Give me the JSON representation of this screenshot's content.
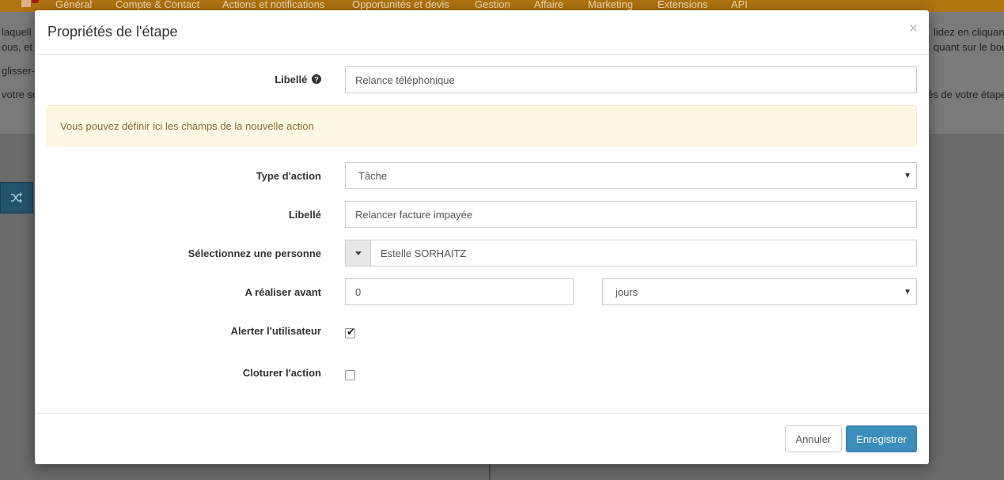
{
  "background": {
    "nav_items": [
      "Général",
      "Compte & Contact",
      "Actions et notifications",
      "Opportunités et devis",
      "Gestion",
      "Affaire",
      "Marketing",
      "Extensions",
      "API"
    ],
    "left_snippets": [
      "laquell",
      "ous, et",
      "glisser-",
      "votre so"
    ],
    "right_snippets": [
      "lidez en cliquant",
      "quant sur le bou",
      "és de votre étape"
    ]
  },
  "modal": {
    "title": "Propriétés de l'étape",
    "close_label": "×",
    "libelle_step": {
      "label": "Libellé",
      "value": "Relance téléphonique"
    },
    "info_message": "Vous pouvez définir ici les champs de la nouvelle action",
    "action_type": {
      "label": "Type d'action",
      "value": "Tâche"
    },
    "action_libelle": {
      "label": "Libellé",
      "value": "Relancer facture impayée"
    },
    "person": {
      "label": "Sélectionnez une personne",
      "value": "Estelle SORHAITZ"
    },
    "due_before": {
      "label": "A réaliser avant",
      "value": "0",
      "unit": "jours"
    },
    "alert_user": {
      "label": "Alerter l'utilisateur",
      "checked": true
    },
    "close_action": {
      "label": "Cloturer l'action",
      "checked": false
    },
    "buttons": {
      "cancel": "Annuler",
      "save": "Enregistrer"
    }
  },
  "colors": {
    "accent": "#3c8dbc",
    "nav": "#b07411",
    "warning_bg": "#fcf8e3",
    "warning_text": "#8a6d3b"
  }
}
